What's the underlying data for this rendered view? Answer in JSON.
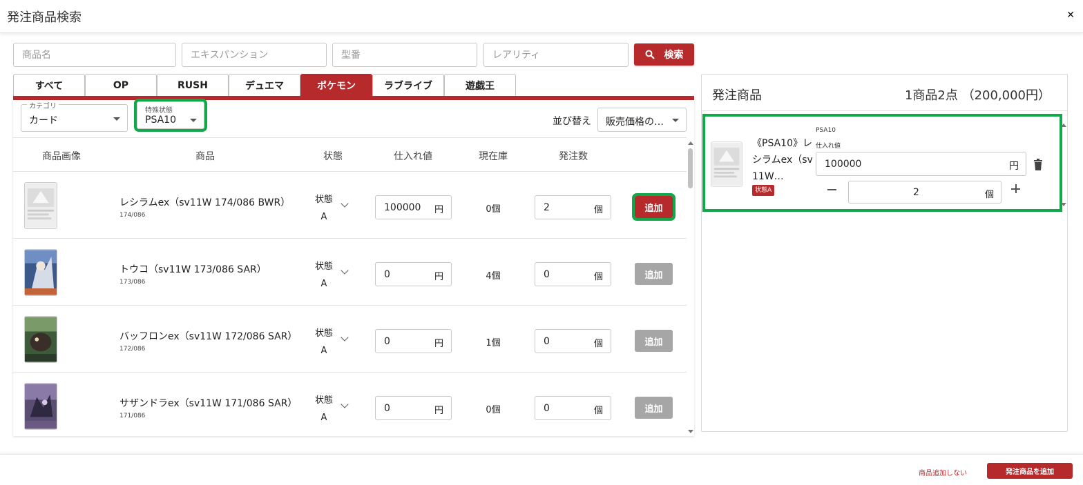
{
  "window": {
    "title": "発注商品検索"
  },
  "search": {
    "name_placeholder": "商品名",
    "expansion_placeholder": "エキスパンション",
    "model_placeholder": "型番",
    "rarity_placeholder": "レアリティ",
    "button_label": "検索"
  },
  "tabs": [
    {
      "label": "すべて"
    },
    {
      "label": "OP"
    },
    {
      "label": "RUSH"
    },
    {
      "label": "デュエマ"
    },
    {
      "label": "ポケモン"
    },
    {
      "label": "ラブライブ"
    },
    {
      "label": "遊戯王"
    }
  ],
  "filters": {
    "category": {
      "label": "カテゴリ",
      "value": "カード"
    },
    "special": {
      "label": "特殊状態",
      "value": "PSA10"
    },
    "sort": {
      "label": "並び替え",
      "value": "販売価格の…"
    }
  },
  "table": {
    "headers": {
      "image": "商品画像",
      "product": "商品",
      "condition": "状態",
      "cost": "仕入れ値",
      "stock": "現在庫",
      "order_qty": "発注数"
    },
    "rows": [
      {
        "name": "レシラムex（sv11W 174/086 BWR）",
        "number": "174/086",
        "cond1": "状態",
        "cond2": "A",
        "cost": "100000",
        "cost_unit": "円",
        "stock": "0個",
        "qty": "2",
        "qty_unit": "個",
        "add": "追加"
      },
      {
        "name": "トウコ（sv11W 173/086 SAR）",
        "number": "173/086",
        "cond1": "状態",
        "cond2": "A",
        "cost": "0",
        "cost_unit": "円",
        "stock": "4個",
        "qty": "0",
        "qty_unit": "個",
        "add": "追加"
      },
      {
        "name": "バッフロンex（sv11W 172/086 SAR）",
        "number": "172/086",
        "cond1": "状態",
        "cond2": "A",
        "cost": "0",
        "cost_unit": "円",
        "stock": "1個",
        "qty": "0",
        "qty_unit": "個",
        "add": "追加"
      },
      {
        "name": "サザンドラex（sv11W 171/086 SAR）",
        "number": "171/086",
        "cond1": "状態",
        "cond2": "A",
        "cost": "0",
        "cost_unit": "円",
        "stock": "0個",
        "qty": "0",
        "qty_unit": "個",
        "add": "追加"
      }
    ]
  },
  "order_panel": {
    "title": "発注商品",
    "summary": "1商品2点 （200,000円）",
    "item": {
      "name": "《PSA10》レシラムex（sv11W…",
      "badge": "状態A",
      "special": "PSA10",
      "cost_label": "仕入れ値",
      "cost": "100000",
      "cost_unit": "円",
      "qty": "2",
      "qty_unit": "個"
    }
  },
  "footer": {
    "no_add": "商品追加しない",
    "add_order": "発注商品を追加"
  },
  "colors": {
    "accent": "#b72a2b",
    "highlight": "#11a84a",
    "disabled": "#a6a6a6"
  }
}
